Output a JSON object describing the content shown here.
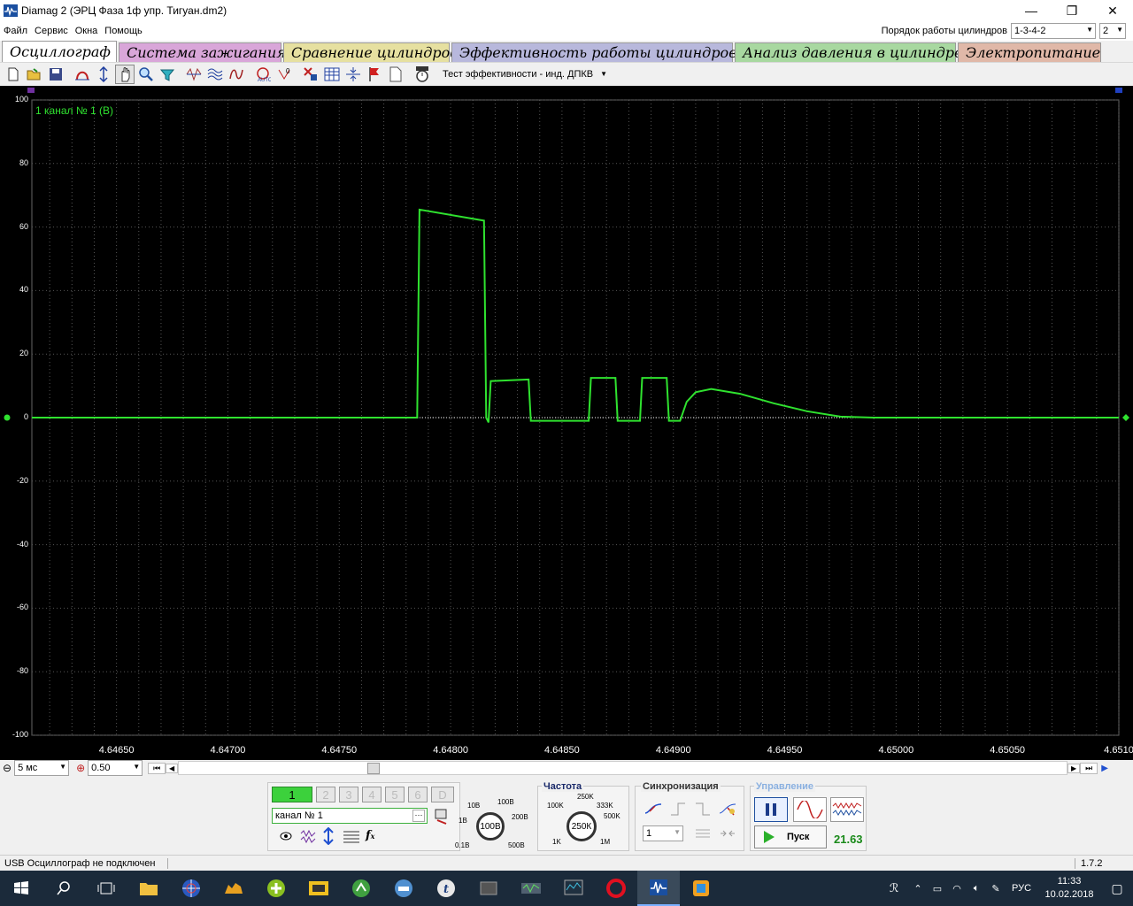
{
  "window": {
    "title": "Diamag 2 (ЭРЦ Фаза 1ф упр. Тигуан.dm2)",
    "minimize": "—",
    "maximize": "❐",
    "close": "✕"
  },
  "menu": [
    "Файл",
    "Сервис",
    "Окна",
    "Помощь"
  ],
  "cylinder_order": {
    "label": "Порядок работы цилиндров",
    "value": "1-3-4-2",
    "count": "2"
  },
  "tabs": [
    {
      "label": "Осциллограф",
      "color": "#ffffff",
      "active": true
    },
    {
      "label": "Система зажигания",
      "color": "#d9a6d9",
      "active": false
    },
    {
      "label": "Сравнение цилиндров",
      "color": "#e6e0a0",
      "active": false
    },
    {
      "label": "Эффективность работы цилиндров",
      "color": "#b8b8dc",
      "active": false
    },
    {
      "label": "Анализ давления в цилиндре",
      "color": "#a8d8a0",
      "active": false
    },
    {
      "label": "Электропитание",
      "color": "#e0b8a8",
      "active": false
    }
  ],
  "toolbar": {
    "test_label": "Тест эффективности - инд. ДПКВ",
    "icons": [
      "new-icon",
      "open-icon",
      "save-icon",
      "measure-icon",
      "cursor-icon",
      "hand-icon",
      "zoom-icon",
      "filter-icon",
      "persist-icon",
      "average-icon",
      "math-icon",
      "auto-icon",
      "zero-icon",
      "marker-icon",
      "grid-icon",
      "center-icon",
      "flag-icon",
      "page-icon",
      "auto-timer-icon"
    ]
  },
  "chart_data": {
    "type": "line",
    "title": "",
    "series": [
      {
        "name": "1 канал № 1 (В)",
        "color": "#2fe22f"
      }
    ],
    "xlabel": "",
    "ylabel": "",
    "ylim": [
      -100,
      100
    ],
    "yticks": [
      "100",
      "80",
      "60",
      "40",
      "20",
      "0",
      "-20",
      "-40",
      "-60",
      "-80",
      "-100"
    ],
    "xticks": [
      "4.64650",
      "4.64700",
      "4.64750",
      "4.64800",
      "4.64850",
      "4.64900",
      "4.64950",
      "4.65000",
      "4.65050",
      "4.6510"
    ],
    "xlim": [
      4.64612,
      4.651
    ],
    "grid": true,
    "points": [
      [
        4.64612,
        0
      ],
      [
        4.64785,
        0
      ],
      [
        4.64786,
        65.5
      ],
      [
        4.64815,
        62
      ],
      [
        4.64816,
        0
      ],
      [
        4.64817,
        -1.5
      ],
      [
        4.64818,
        11.5
      ],
      [
        4.64835,
        12
      ],
      [
        4.64836,
        -1
      ],
      [
        4.64862,
        -1
      ],
      [
        4.64863,
        12.5
      ],
      [
        4.64874,
        12.5
      ],
      [
        4.64875,
        -1
      ],
      [
        4.64885,
        -1
      ],
      [
        4.64886,
        12.5
      ],
      [
        4.64897,
        12.5
      ],
      [
        4.64898,
        -1
      ],
      [
        4.64903,
        -1
      ],
      [
        4.64906,
        5
      ],
      [
        4.6491,
        8
      ],
      [
        4.64917,
        9
      ],
      [
        4.6493,
        7.5
      ],
      [
        4.64945,
        4.5
      ],
      [
        4.6496,
        2
      ],
      [
        4.64975,
        0.3
      ],
      [
        4.6499,
        0
      ],
      [
        4.651,
        0
      ]
    ]
  },
  "hbar": {
    "timebase": "5 мс",
    "gain": "0.50",
    "first_icon": "⏮",
    "prev_icon": "◀",
    "next_icon": "▶",
    "last_icon": "⏭"
  },
  "channels": {
    "buttons": [
      "1",
      "2",
      "3",
      "4",
      "5",
      "6",
      "D"
    ],
    "name": "канал № 1",
    "dots": "···"
  },
  "range_knob": {
    "value": "100В",
    "labels": [
      "10В",
      "100В",
      "1В",
      "200В",
      "0.1В",
      "500В"
    ]
  },
  "freq_knob": {
    "title": "Частота",
    "value": "250К",
    "labels": [
      "250K",
      "100K",
      "333K",
      "500K",
      "1K",
      "1M"
    ]
  },
  "sync": {
    "title": "Синхронизация",
    "value": "1"
  },
  "control": {
    "title": "Управление",
    "start": "Пуск",
    "readout": "21.63"
  },
  "status": {
    "text": "USB Осциллограф не подключен",
    "version": "1.7.2"
  },
  "tray": {
    "lang": "РУС",
    "time": "11:33",
    "date": "10.02.2018"
  }
}
